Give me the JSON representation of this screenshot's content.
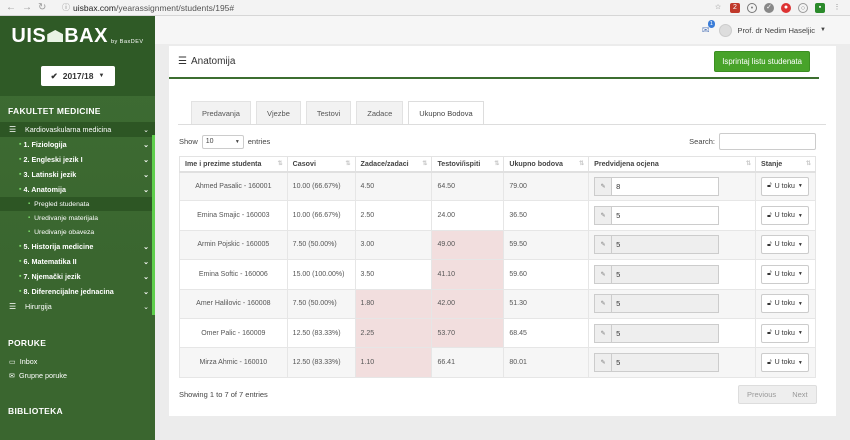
{
  "browser": {
    "url_host": "uisbax.com",
    "url_path": "/yearassignment/students/195#",
    "badge_count": "2"
  },
  "sidebar": {
    "logo_left": "UIS",
    "logo_right": "BAX",
    "logo_sub": "by BaxDEV",
    "year": "2017/18",
    "faculty_title": "FAKULTET MEDICINE",
    "menu": [
      {
        "label": "Kardiovaskularna medicina"
      },
      {
        "label": "1. Fiziologija"
      },
      {
        "label": "2. Engleski jezik I"
      },
      {
        "label": "3. Latinski jezik"
      },
      {
        "label": "4. Anatomija"
      },
      {
        "label": "Pregled studenata"
      },
      {
        "label": "Uredivanje materijala"
      },
      {
        "label": "Uredivanje obaveza"
      },
      {
        "label": "5. Historija medicine"
      },
      {
        "label": "6. Matematika II"
      },
      {
        "label": "7. Njemački jezik"
      },
      {
        "label": "8. Diferencijalne jednacina"
      },
      {
        "label": "Hirurgija"
      }
    ],
    "poruke_title": "PORUKE",
    "inbox": "Inbox",
    "grupne": "Grupne poruke",
    "biblioteka_title": "BIBLIOTEKA"
  },
  "topbar": {
    "mail_count": "1",
    "user_name": "Prof. dr Nedim Haseljic"
  },
  "panel": {
    "title": "Anatomija",
    "print_button": "Isprintaj listu studenata"
  },
  "tabs": [
    "Predavanja",
    "Vjezbe",
    "Testovi",
    "Zadace",
    "Ukupno Bodova"
  ],
  "table_controls": {
    "show_label": "Show",
    "length_value": "10",
    "entries_label": "entries",
    "search_label": "Search:"
  },
  "table": {
    "headers": [
      "Ime i prezime studenta",
      "Casovi",
      "Zadace/zadaci",
      "Testovi/ispiti",
      "Ukupno bodova",
      "Predvidjena ocjena",
      "Stanje"
    ],
    "rows": [
      {
        "name": "Ahmed Pasalic - 160001",
        "casovi": "10.00 (66.67%)",
        "zadace": "4.50",
        "testovi": "64.50",
        "ukupno": "79.00",
        "ocjena": "8",
        "stanje": "U toku"
      },
      {
        "name": "Emina Smajic - 160003",
        "casovi": "10.00 (66.67%)",
        "zadace": "2.50",
        "testovi": "24.00",
        "ukupno": "36.50",
        "ocjena": "5",
        "stanje": "U toku"
      },
      {
        "name": "Armin Pojskic - 160005",
        "casovi": "7.50 (50.00%)",
        "zadace": "3.00",
        "testovi": "49.00",
        "ukupno": "59.50",
        "ocjena": "5",
        "stanje": "U toku"
      },
      {
        "name": "Emina Softic - 160006",
        "casovi": "15.00 (100.00%)",
        "zadace": "3.50",
        "testovi": "41.10",
        "ukupno": "59.60",
        "ocjena": "5",
        "stanje": "U toku"
      },
      {
        "name": "Amer Halilovic - 160008",
        "casovi": "7.50 (50.00%)",
        "zadace": "1.80",
        "testovi": "42.00",
        "ukupno": "51.30",
        "ocjena": "5",
        "stanje": "U toku"
      },
      {
        "name": "Omer Palic - 160009",
        "casovi": "12.50 (83.33%)",
        "zadace": "2.25",
        "testovi": "53.70",
        "ukupno": "68.45",
        "ocjena": "5",
        "stanje": "U toku"
      },
      {
        "name": "Mirza Ahmic - 160010",
        "casovi": "12.50 (83.33%)",
        "zadace": "1.10",
        "testovi": "66.41",
        "ukupno": "80.01",
        "ocjena": "5",
        "stanje": "U toku"
      }
    ]
  },
  "footer": {
    "info": "Showing 1 to 7 of 7 entries",
    "previous": "Previous",
    "next": "Next"
  }
}
